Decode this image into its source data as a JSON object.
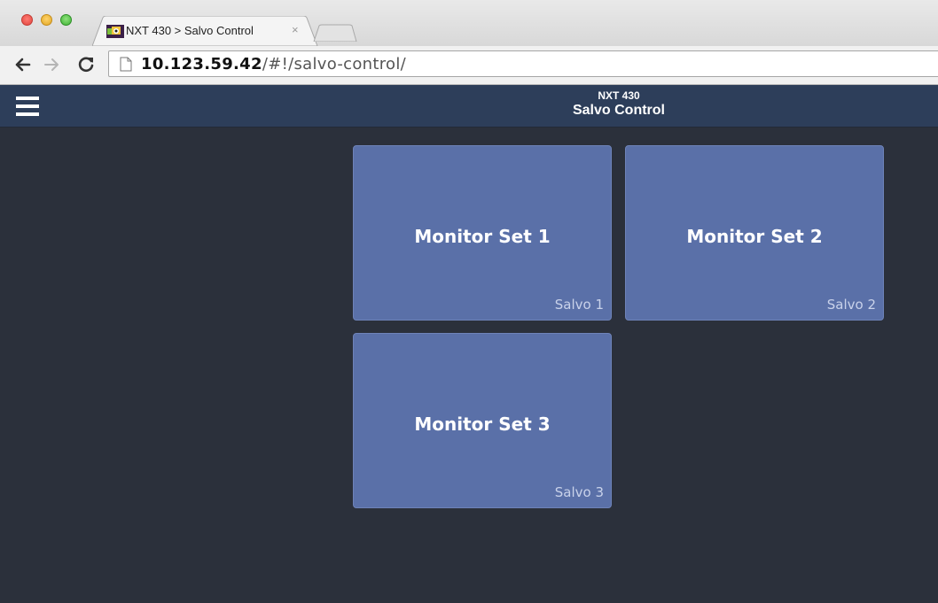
{
  "browser": {
    "tab": {
      "title": "NXT 430 > Salvo Control",
      "close_glyph": "×"
    },
    "address_bar": {
      "host": "10.123.59.42",
      "path": "/#!/salvo-control/"
    },
    "icons": [
      "back-icon",
      "forward-icon",
      "reload-icon",
      "page-icon"
    ]
  },
  "app": {
    "header": {
      "subtitle": "NXT 430",
      "title": "Salvo Control",
      "menu_icon": "hamburger-icon"
    },
    "salvos": [
      {
        "name": "Monitor Set 1",
        "label": "Salvo 1"
      },
      {
        "name": "Monitor Set 2",
        "label": "Salvo 2"
      },
      {
        "name": "Monitor Set 3",
        "label": "Salvo 3"
      }
    ],
    "colors": {
      "header_bg": "#2d3e5a",
      "content_bg": "#2b303b",
      "tile_bg": "#5a70a8"
    }
  }
}
